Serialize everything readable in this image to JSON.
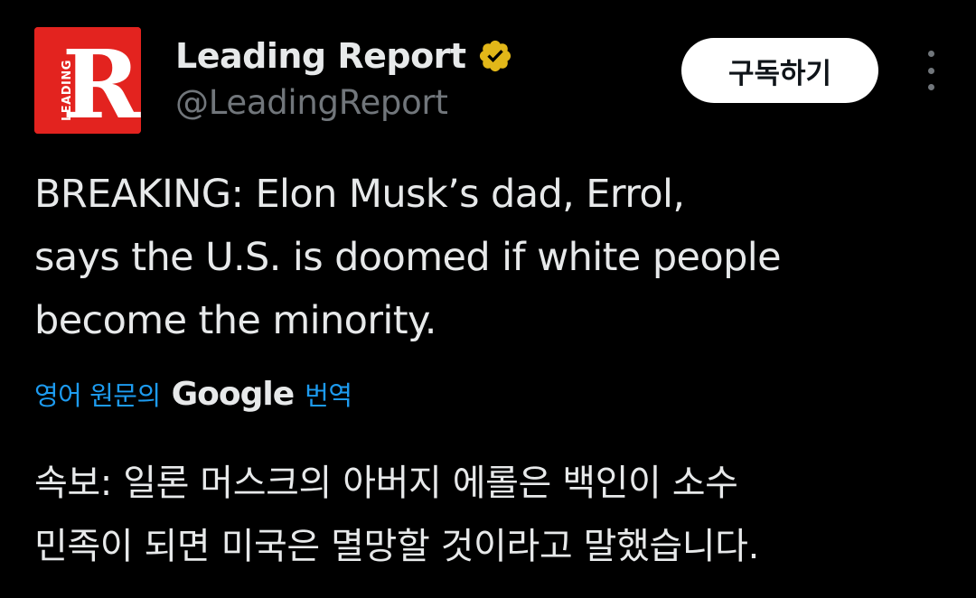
{
  "author": {
    "display_name": "Leading Report",
    "handle": "@LeadingReport",
    "verified_icon": "gold-verified-badge-icon",
    "avatar": {
      "letter": "R",
      "text": "LEADING",
      "color": "#e3231f"
    }
  },
  "actions": {
    "subscribe_label": "구독하기",
    "more_icon": "more-vertical-icon"
  },
  "tweet": {
    "text": "BREAKING: Elon Musk’s dad, Errol,\nsays the U.S. is doomed if white people\nbecome the minority.",
    "translation_prefix": "영어 원문의",
    "translation_provider": "Google",
    "translation_suffix": "번역",
    "translated_text": "속보: 일론 머스크의 아버지 에롤은 백인이 소수\n민족이 되면 미국은 멸망할 것이라고 말했습니다."
  },
  "colors": {
    "background": "#000000",
    "text": "#e7e9ea",
    "muted": "#71767b",
    "link": "#1d9bf0",
    "verified": "#e2b719"
  }
}
